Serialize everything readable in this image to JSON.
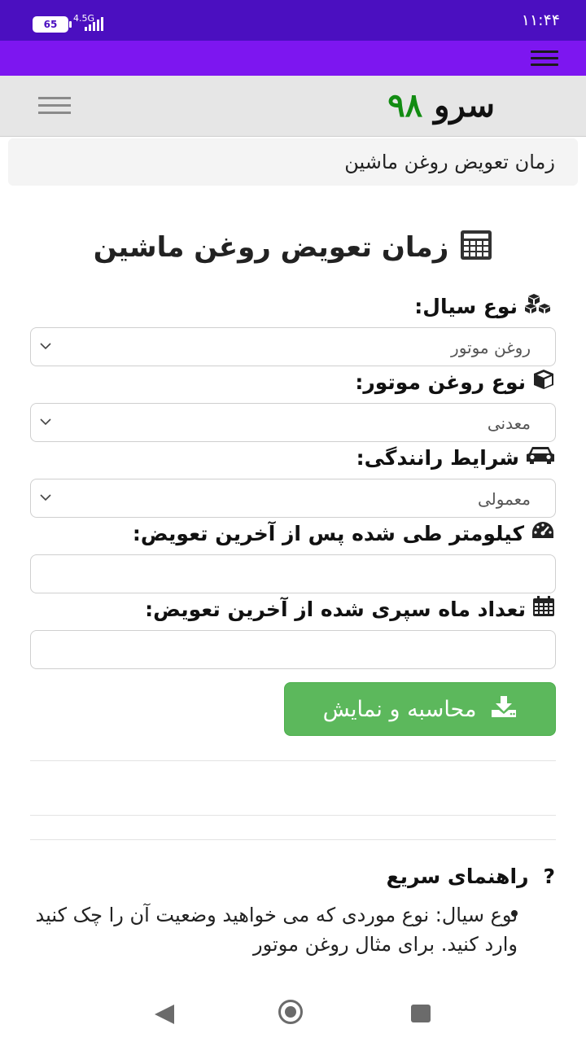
{
  "status_bar": {
    "time": "۱۱:۴۴",
    "battery": "65",
    "network": "4.5G"
  },
  "header": {
    "brand_word": "سرو",
    "brand_number": "۹۸"
  },
  "breadcrumb": "زمان تعویض روغن ماشین",
  "page_title": "زمان تعویض روغن ماشین",
  "form": {
    "fluid_type": {
      "label": "نوع سیال:",
      "value": "روغن موتور"
    },
    "oil_type": {
      "label": "نوع روغن موتور:",
      "value": "معدنی"
    },
    "driving_conditions": {
      "label": "شرایط رانندگی:",
      "value": "معمولی"
    },
    "km_since_change": {
      "label": "کیلومتر طی شده پس از آخرین تعویض:",
      "value": ""
    },
    "months_since_change": {
      "label": "تعداد ماه سپری شده از آخرین تعویض:",
      "value": ""
    },
    "submit_label": "محاسبه و نمایش"
  },
  "guide": {
    "title": "راهنمای سریع",
    "items": [
      "نوع سیال: نوع موردی که می خواهید وضعیت آن را چک کنید وارد کنید. برای مثال روغن موتور"
    ]
  },
  "colors": {
    "status_bar": "#4b0fc0",
    "top_bar": "#7d16f0",
    "brand_green": "#128c12",
    "button_green": "#5cb85c"
  }
}
